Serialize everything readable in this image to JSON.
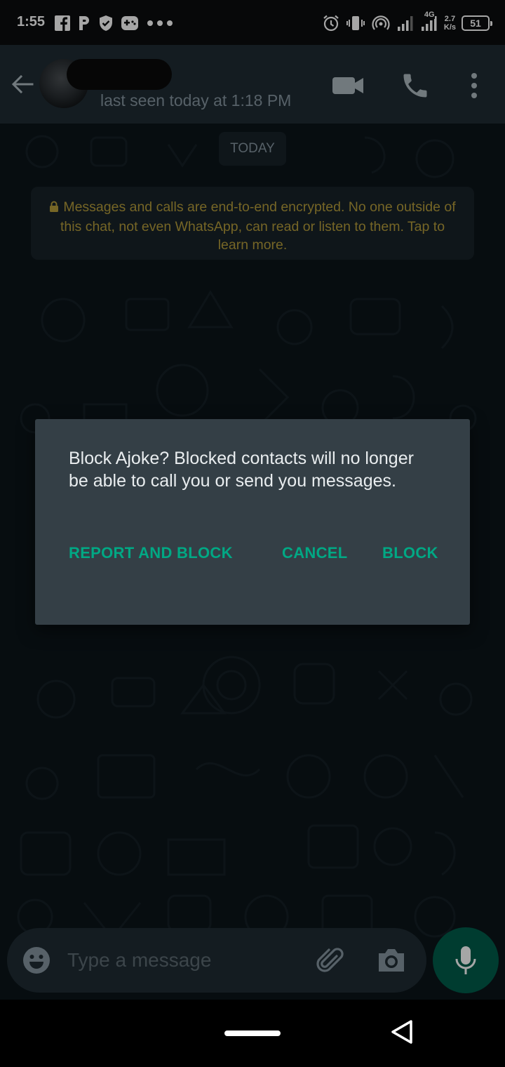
{
  "status_bar": {
    "time": "1:55",
    "network_badge": "4G",
    "net_speed_value": "2.7",
    "net_speed_unit": "K/s",
    "battery_level": "51",
    "left_icons": [
      "facebook-icon",
      "p-app-icon",
      "shield-check-icon",
      "gamepad-icon",
      "more-dots-icon"
    ],
    "right_icons": [
      "alarm-icon",
      "vibrate-icon",
      "hotspot-icon",
      "signal-icon",
      "signal-4g-icon",
      "battery-icon"
    ]
  },
  "header": {
    "last_seen": "last seen today at 1:18 PM",
    "icons": [
      "back-arrow-icon",
      "video-camera-icon",
      "phone-icon",
      "more-vert-icon"
    ]
  },
  "chat": {
    "date_chip": "TODAY",
    "encryption_notice": "Messages and calls are end-to-end encrypted. No one outside of this chat, not even WhatsApp, can read or listen to them. Tap to learn more."
  },
  "dialog": {
    "message": "Block Ajoke? Blocked contacts will no longer be able to call you or send you messages.",
    "report_and_block_label": "REPORT AND BLOCK",
    "cancel_label": "CANCEL",
    "block_label": "BLOCK"
  },
  "input_bar": {
    "placeholder": "Type a message",
    "value": ""
  },
  "colors": {
    "accent": "#00a884",
    "header_bg": "#1f2c34",
    "chat_bg": "#0b141a",
    "dialog_bg": "#343f46",
    "notice_text": "#b59d3b",
    "mic_bg": "#005c4b"
  }
}
